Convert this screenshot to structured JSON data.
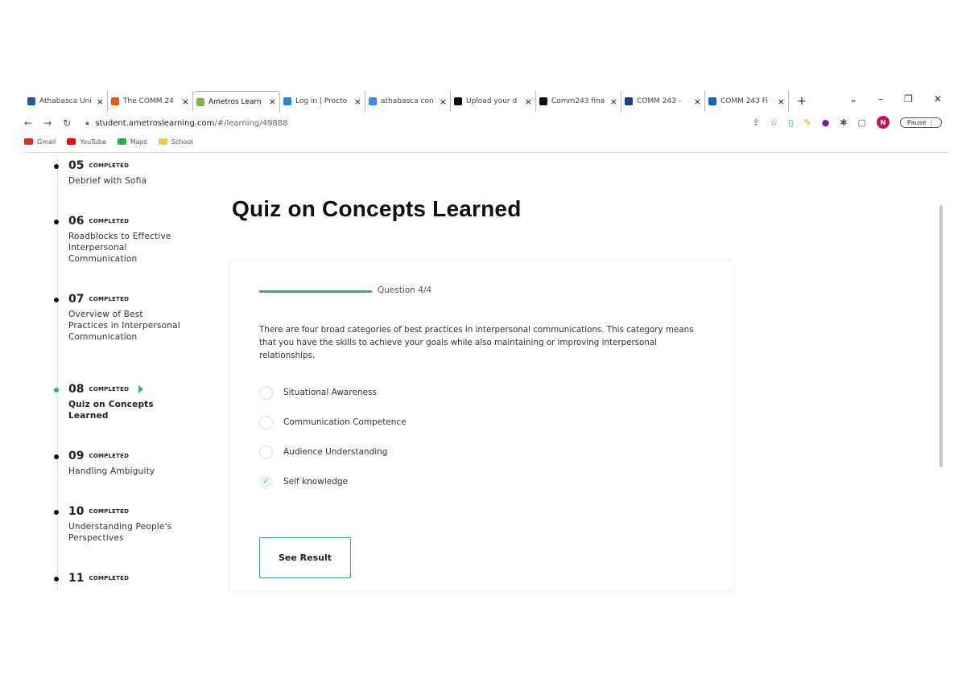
{
  "browser": {
    "tabs": [
      {
        "title": "Athabasca Uni",
        "color": "#2b579a",
        "active": false
      },
      {
        "title": "The COMM 24",
        "color": "#e8590c",
        "active": false
      },
      {
        "title": "Ametros Learn",
        "color": "#7cb342",
        "active": true
      },
      {
        "title": "Log in | Procto",
        "color": "#1e88e5",
        "active": false
      },
      {
        "title": "athabasca con",
        "color": "#4285f4",
        "active": false
      },
      {
        "title": "Upload your d",
        "color": "#111111",
        "active": false
      },
      {
        "title": "Comm243 fina",
        "color": "#111111",
        "active": false
      },
      {
        "title": "COMM 243 -",
        "color": "#1a3d8f",
        "active": false
      },
      {
        "title": "COMM 243 Fi",
        "color": "#1565c0",
        "active": false
      }
    ],
    "new_tab_icon": "+",
    "minimize_icon": "chevron-down-icon",
    "url_host": "student.ametroslearning.com",
    "url_path": "/#/learning/49888",
    "profile_initial": "N",
    "paused_label": "Pause",
    "bookmarks": [
      {
        "label": "Gmail",
        "color": "#d93025"
      },
      {
        "label": "YouTube",
        "color": "#ff0000"
      },
      {
        "label": "Maps",
        "color": "#34a853"
      },
      {
        "label": "School",
        "color": "#f6c744"
      }
    ]
  },
  "sidebar": {
    "lessons": [
      {
        "num": "05",
        "status": "COMPLETED",
        "title": "Debrief with Sofia",
        "active": false
      },
      {
        "num": "06",
        "status": "COMPLETED",
        "title": "Roadblocks to Effective Interpersonal Communication",
        "active": false
      },
      {
        "num": "07",
        "status": "COMPLETED",
        "title": "Overview of Best Practices in Interpersonal Communication",
        "active": false
      },
      {
        "num": "08",
        "status": "COMPLETED",
        "title": "Quiz on Concepts Learned",
        "active": true
      },
      {
        "num": "09",
        "status": "COMPLETED",
        "title": "Handling Ambiguity",
        "active": false
      },
      {
        "num": "10",
        "status": "COMPLETED",
        "title": "Understanding People's Perspectives",
        "active": false
      },
      {
        "num": "11",
        "status": "COMPLETED",
        "title": "",
        "active": false
      }
    ]
  },
  "main": {
    "title": "Quiz on Concepts Learned",
    "progress_label": "Question 4/4",
    "progress_fraction": 1.0,
    "question": "There are four broad categories of best practices in interpersonal communications. This category means that you have the skills to achieve your goals while also maintaining or improving interpersonal relationships.",
    "options": [
      {
        "label": "Situational Awareness",
        "checked": false
      },
      {
        "label": "Communication Competence",
        "checked": false
      },
      {
        "label": "Audience Understanding",
        "checked": false
      },
      {
        "label": "Self knowledge",
        "checked": true
      }
    ],
    "see_result_label": "See Result"
  },
  "colors": {
    "accent": "#3aaa8e"
  }
}
